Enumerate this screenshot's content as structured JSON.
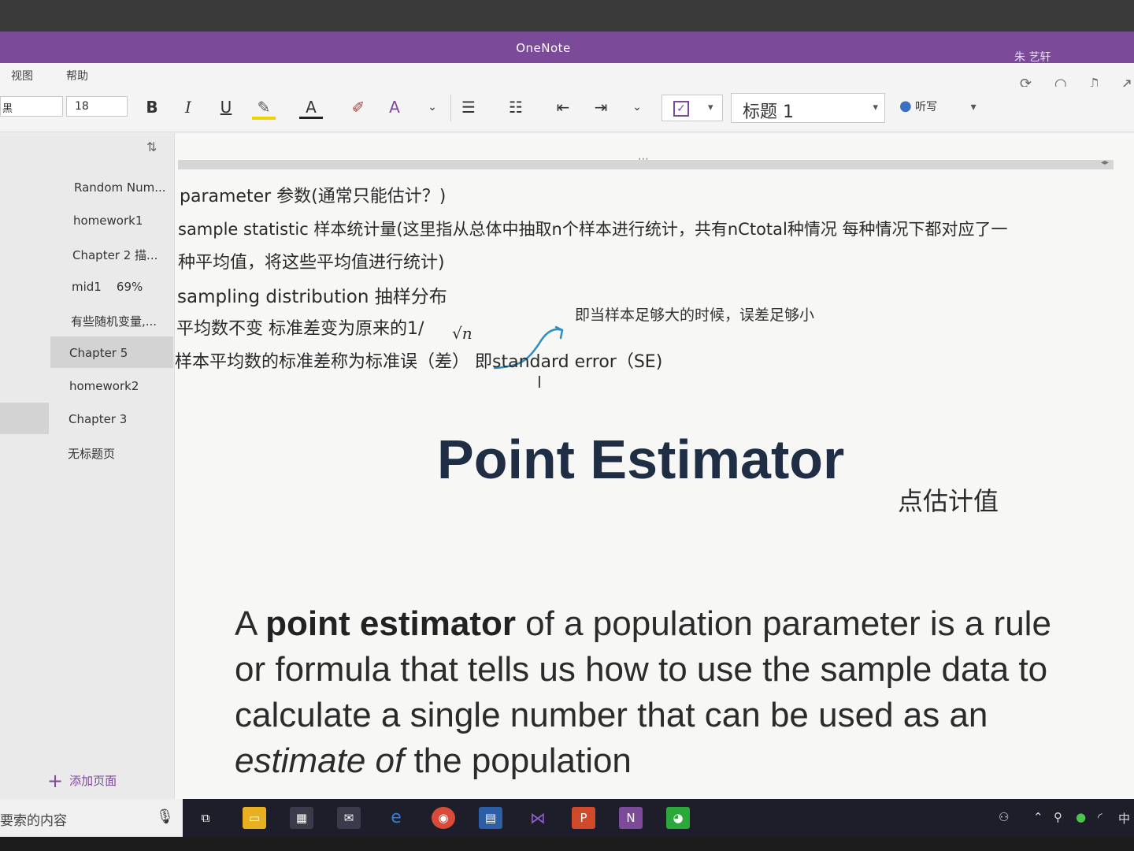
{
  "app": {
    "title": "OneNote",
    "user": "朱 艺轩"
  },
  "menu": {
    "items": [
      "视图",
      "帮助"
    ]
  },
  "ribbon": {
    "font_name": "黑",
    "font_size": "18",
    "bold": "B",
    "italic": "I",
    "underline": "U",
    "style": "标题 1",
    "dictate": "听写"
  },
  "pages": [
    {
      "label": "Random Num..."
    },
    {
      "label": "homework1"
    },
    {
      "label": "Chapter 2 描..."
    },
    {
      "label": "mid1    69%"
    },
    {
      "label": "有些随机变量,..."
    },
    {
      "label": "Chapter 5"
    },
    {
      "label": "homework2"
    },
    {
      "label": "Chapter 3"
    },
    {
      "label": "无标题页"
    }
  ],
  "add_page": "添加页面",
  "notes": {
    "line1": "parameter    参数(通常只能估计？)",
    "line2": "sample statistic 样本统计量(这里指从总体中抽取n个样本进行统计，共有nCtotal种情况 每种情况下都对应了一",
    "line3": "种平均值，将这些平均值进行统计)",
    "line4": "sampling distribution   抽样分布",
    "line5": "平均数不变 标准差变为原来的1/",
    "sqrt": "√n",
    "annotation": "即当样本足够大的时候，误差足够小",
    "line6": "样本平均数的标准差称为标准误（差） 即standard error（SE)"
  },
  "slide": {
    "title": "Point Estimator",
    "title_cn": "点估计值",
    "p1": "A ",
    "p2": "point estimator",
    "p3": " of a population parameter is a rule or formula that tells us how to use the sample data to calculate a single number that can be used as an ",
    "p4": "estimate of",
    "p5": " the population"
  },
  "taskbar": {
    "search_text": "要索的内容",
    "ime": "中"
  },
  "colors": {
    "titlebar": "#7b4a98",
    "slide_title": "#1f2d45",
    "ink": "#2e8fc0"
  }
}
